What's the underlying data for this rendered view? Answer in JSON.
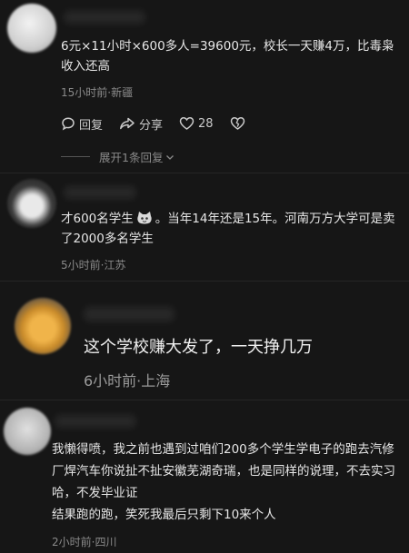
{
  "comments": [
    {
      "text": "6元×11小时×600多人=39600元，校长一天赚4万，比毒枭收入还高",
      "meta": "15小时前·新疆",
      "actions": {
        "reply": "回复",
        "share": "分享",
        "likes": "28"
      },
      "expand": "展开1条回复"
    },
    {
      "text_a": "才600名学生",
      "text_b": "。当年14年还是15年。河南万方大学可是卖了2000多名学生",
      "meta": "5小时前·江苏"
    },
    {
      "text": "这个学校赚大发了，一天挣几万",
      "meta": "6小时前·上海"
    },
    {
      "text": "我懒得喷，我之前也遇到过咱们200多个学生学电子的跑去汽修厂焊汽车你说扯不扯安徽芜湖奇瑞，也是同样的说理，不去实习哈，不发毕业证\n结果跑的跑，笑死我最后只剩下10来个人",
      "meta": "2小时前·四川"
    }
  ],
  "icons": {
    "reply": "comment-bubble-icon",
    "share": "share-arrow-icon",
    "like": "heart-icon",
    "dislike": "broken-heart-icon",
    "expand": "chevron-down-icon",
    "emoji": "cat-face-emoji-icon"
  },
  "colors": {
    "background": "#161616",
    "text": "#e6e6e6",
    "meta": "#8a8a8a"
  }
}
